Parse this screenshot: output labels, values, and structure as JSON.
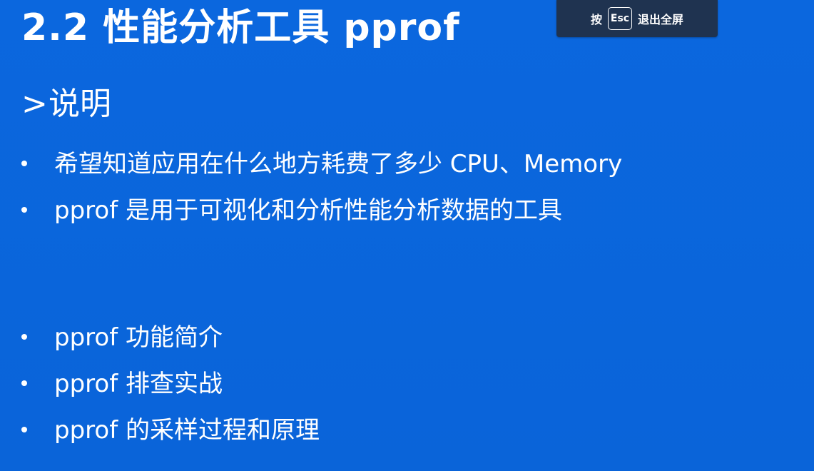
{
  "slide": {
    "title": "2.2 性能分析工具 pprof",
    "section_marker": ">",
    "section_heading": "说明",
    "bullets": [
      "希望知道应用在什么地方耗费了多少 CPU、Memory",
      "pprof 是用于可视化和分析性能分析数据的工具",
      "pprof 功能简介",
      "pprof 排查实战",
      "pprof 的采样过程和原理"
    ]
  },
  "fullscreen_banner": {
    "prefix": "按",
    "key": "Esc",
    "suffix": "退出全屏"
  },
  "colors": {
    "background": "#0a66dd",
    "banner": "#1f3350",
    "text": "#ffffff"
  }
}
